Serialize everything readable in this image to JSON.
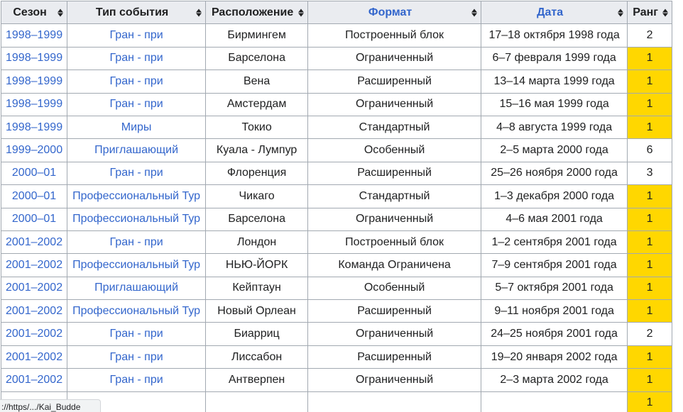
{
  "headers": [
    {
      "label": "Сезон",
      "link": false
    },
    {
      "label": "Тип события",
      "link": false
    },
    {
      "label": "Расположение",
      "link": false
    },
    {
      "label": "Формат",
      "link": true
    },
    {
      "label": "Дата",
      "link": true
    },
    {
      "label": "Ранг",
      "link": false
    }
  ],
  "rows": [
    {
      "season": "1998–1999",
      "type": "Гран - при",
      "location": "Бирмингем",
      "format": "Построенный блок",
      "date": "17–18 октября 1998 года",
      "rank": "2",
      "gold": false
    },
    {
      "season": "1998–1999",
      "type": "Гран - при",
      "location": "Барселона",
      "format": "Ограниченный",
      "date": "6–7 февраля 1999 года",
      "rank": "1",
      "gold": true
    },
    {
      "season": "1998–1999",
      "type": "Гран - при",
      "location": "Вена",
      "format": "Расширенный",
      "date": "13–14 марта 1999 года",
      "rank": "1",
      "gold": true
    },
    {
      "season": "1998–1999",
      "type": "Гран - при",
      "location": "Амстердам",
      "format": "Ограниченный",
      "date": "15–16 мая 1999 года",
      "rank": "1",
      "gold": true
    },
    {
      "season": "1998–1999",
      "type": "Миры",
      "location": "Токио",
      "format": "Стандартный",
      "date": "4–8 августа 1999 года",
      "rank": "1",
      "gold": true
    },
    {
      "season": "1999–2000",
      "type": "Приглашающий",
      "location": "Куала - Лумпур",
      "format": "Особенный",
      "date": "2–5 марта 2000 года",
      "rank": "6",
      "gold": false
    },
    {
      "season": "2000–01",
      "type": "Гран - при",
      "location": "Флоренция",
      "format": "Расширенный",
      "date": "25–26 ноября 2000 года",
      "rank": "3",
      "gold": false
    },
    {
      "season": "2000–01",
      "type": "Профессиональный Тур",
      "location": "Чикаго",
      "format": "Стандартный",
      "date": "1–3 декабря 2000 года",
      "rank": "1",
      "gold": true
    },
    {
      "season": "2000–01",
      "type": "Профессиональный Тур",
      "location": "Барселона",
      "format": "Ограниченный",
      "date": "4–6 мая 2001 года",
      "rank": "1",
      "gold": true
    },
    {
      "season": "2001–2002",
      "type": "Гран - при",
      "location": "Лондон",
      "format": "Построенный блок",
      "date": "1–2 сентября 2001 года",
      "rank": "1",
      "gold": true
    },
    {
      "season": "2001–2002",
      "type": "Профессиональный Тур",
      "location": "НЬЮ-ЙОРК",
      "format": "Команда Ограничена",
      "date": "7–9 сентября 2001 года",
      "rank": "1",
      "gold": true
    },
    {
      "season": "2001–2002",
      "type": "Приглашающий",
      "location": "Кейптаун",
      "format": "Особенный",
      "date": "5–7 октября 2001 года",
      "rank": "1",
      "gold": true
    },
    {
      "season": "2001–2002",
      "type": "Профессиональный Тур",
      "location": "Новый Орлеан",
      "format": "Расширенный",
      "date": "9–11 ноября 2001 года",
      "rank": "1",
      "gold": true
    },
    {
      "season": "2001–2002",
      "type": "Гран - при",
      "location": "Биарриц",
      "format": "Ограниченный",
      "date": "24–25 ноября 2001 года",
      "rank": "2",
      "gold": false
    },
    {
      "season": "2001–2002",
      "type": "Гран - при",
      "location": "Лиссабон",
      "format": "Расширенный",
      "date": "19–20 января 2002 года",
      "rank": "1",
      "gold": true
    },
    {
      "season": "2001–2002",
      "type": "Гран - при",
      "location": "Антверпен",
      "format": "Ограниченный",
      "date": "2–3 марта 2002 года",
      "rank": "1",
      "gold": true
    },
    {
      "season": "",
      "type": "",
      "location": "",
      "format": "",
      "date": "",
      "rank": "1",
      "gold": true
    }
  ],
  "status_bar": {
    "url": "://https/.../Kai_Budde"
  },
  "colors": {
    "link": "#3366cc",
    "gold": "#ffd700",
    "header_bg": "#eaecf0",
    "border": "#a2a9b1"
  }
}
